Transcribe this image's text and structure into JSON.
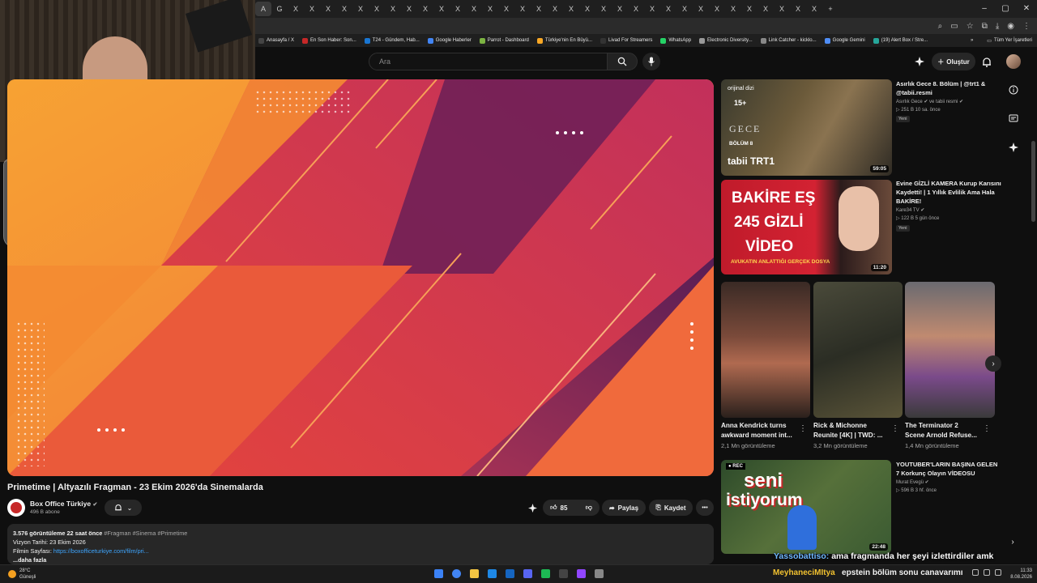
{
  "browser": {
    "tabs": [
      "A",
      "G",
      "X",
      "X",
      "X",
      "X",
      "X",
      "X",
      "X",
      "X",
      "X",
      "X",
      "X",
      "X",
      "X",
      "X",
      "X",
      "X",
      "X",
      "X",
      "X",
      "X",
      "X",
      "X",
      "X",
      "X",
      "X",
      "X",
      "X",
      "X",
      "X",
      "X",
      "X",
      "X",
      "X",
      "+"
    ],
    "window_controls": [
      "–",
      "▢",
      "✕"
    ],
    "bookmarks": [
      {
        "label": "Anasayfa / X",
        "color": "#444"
      },
      {
        "label": "En Son Haber: Son...",
        "color": "#c62828"
      },
      {
        "label": "T24 - Gündem, Hab...",
        "color": "#1976d2"
      },
      {
        "label": "Google Haberler",
        "color": "#4285f4"
      },
      {
        "label": "Parrot - Dashboard",
        "color": "#7cb342"
      },
      {
        "label": "Türkiye'nin En Büyü...",
        "color": "#f9a825"
      },
      {
        "label": "Livad For Streamers",
        "color": "#333"
      },
      {
        "label": "WhatsApp",
        "color": "#25d366"
      },
      {
        "label": "Electronic Diversity...",
        "color": "#999"
      },
      {
        "label": "Link Catcher - kicklo...",
        "color": "#888"
      },
      {
        "label": "Google Gemini",
        "color": "#4f8df5"
      },
      {
        "label": "(19) Alert Box / Stre...",
        "color": "#26a69a"
      }
    ],
    "bookmarks_more": "»",
    "all_bookmarks": "Tüm Yer İşaretleri"
  },
  "youtube": {
    "search_placeholder": "Ara",
    "create_label": "Oluştur",
    "video": {
      "title": "Primetime | Altyazılı Fragman - 23 Ekim 2026'da Sinemalarda",
      "channel": "Box Office Türkiye",
      "verified": "✔",
      "subscribers": "496 B abone",
      "likes": "85",
      "share": "Paylaş",
      "save": "Kaydet",
      "more": "•••",
      "description": {
        "stats": "3.576 görüntüleme  22 saat önce",
        "tags": "#Fragman #Sinema #Primetime",
        "line2": "Vizyon Tarihi: 23 Ekim 2026",
        "line3_label": "Filmin Sayfası:",
        "line3_link": "https://boxofficeturkiye.com/film/pri...",
        "more": "...daha fazla"
      }
    },
    "recommendations": [
      {
        "title_l1": "Asırlık Gece 8. Bölüm | @trt1 &",
        "title_l2": "@tabii.resmi",
        "channel": "Asırlık Gece ✔ ve tabii resmi ✔",
        "meta": "▷ 251 B  10 sa. önce",
        "badge": "Yeni",
        "duration": "59:05",
        "thumb_top": "orijinal dizi",
        "thumb_mid": "15+",
        "thumb_name": "GECE",
        "thumb_ep": "BÖLÜM 8",
        "thumb_brand": "tabii  TRT1"
      },
      {
        "title_l1": "Evine GİZLİ KAMERA Kurup Karısını",
        "title_l2": "Kaydetti! | 1 Yıllık Evlilik Ama Hala",
        "title_l3": "BAKİRE!",
        "channel": "Kare34 TV ✔",
        "meta": "▷ 122 B  5 gün önce",
        "badge": "Yeni",
        "duration": "11:20",
        "thumb_l1": "BAKİRE EŞ",
        "thumb_l2": "245 GİZLİ",
        "thumb_l3": "VİDEO",
        "thumb_l4": "AVUKATIN ANLATTIĞI GERÇEK DOSYA"
      },
      {
        "title_l1": "YOUTUBER'LARIN BAŞINA GELEN",
        "title_l2": "7 Korkunç Olayın VİDEOSU",
        "channel": "Murat Evegü ✔",
        "meta": "▷ 596 B  3 hf. önce",
        "duration": "22:48",
        "thumb_rec": "● REC",
        "thumb_text1": "seni",
        "thumb_text2": "istiyorum"
      }
    ],
    "shorts": [
      {
        "title_l1": "Anna Kendrick turns",
        "title_l2": "awkward moment int...",
        "views": "2,1 Mn görüntüleme"
      },
      {
        "title_l1": "Rick & Michonne",
        "title_l2": "Reunite [4K] | TWD: ...",
        "views": "3,2 Mn görüntüleme"
      },
      {
        "title_l1": "The Terminator 2",
        "title_l2": "Scene Arnold Refuse...",
        "views": "1,4 Mn görüntüleme"
      }
    ],
    "shorts_next": "›",
    "page_next": "›",
    "short_menu": "⋮"
  },
  "stream_overlay": {
    "chat_user": "Yassobattiso:",
    "chat_message": "ama fragmanda her şeyi izlettirdiler amk"
  },
  "taskbar": {
    "temp": "28°C",
    "weather": "Güneşli",
    "ticker_user": "MeyhaneciMItya",
    "ticker_text": "epstein bölüm sonu canavarımı",
    "time": "11:33",
    "date": "8.08.2026",
    "apps": [
      "#3b82f6",
      "#4285f4",
      "#f4c542",
      "#1e88e5",
      "#1565c0",
      "#5865f2",
      "#1db954",
      "#444",
      "#9146ff",
      "#888"
    ]
  },
  "colors": {
    "accent": "#ff0000",
    "link": "#3ea6ff",
    "bg": "#0f0f0f"
  }
}
